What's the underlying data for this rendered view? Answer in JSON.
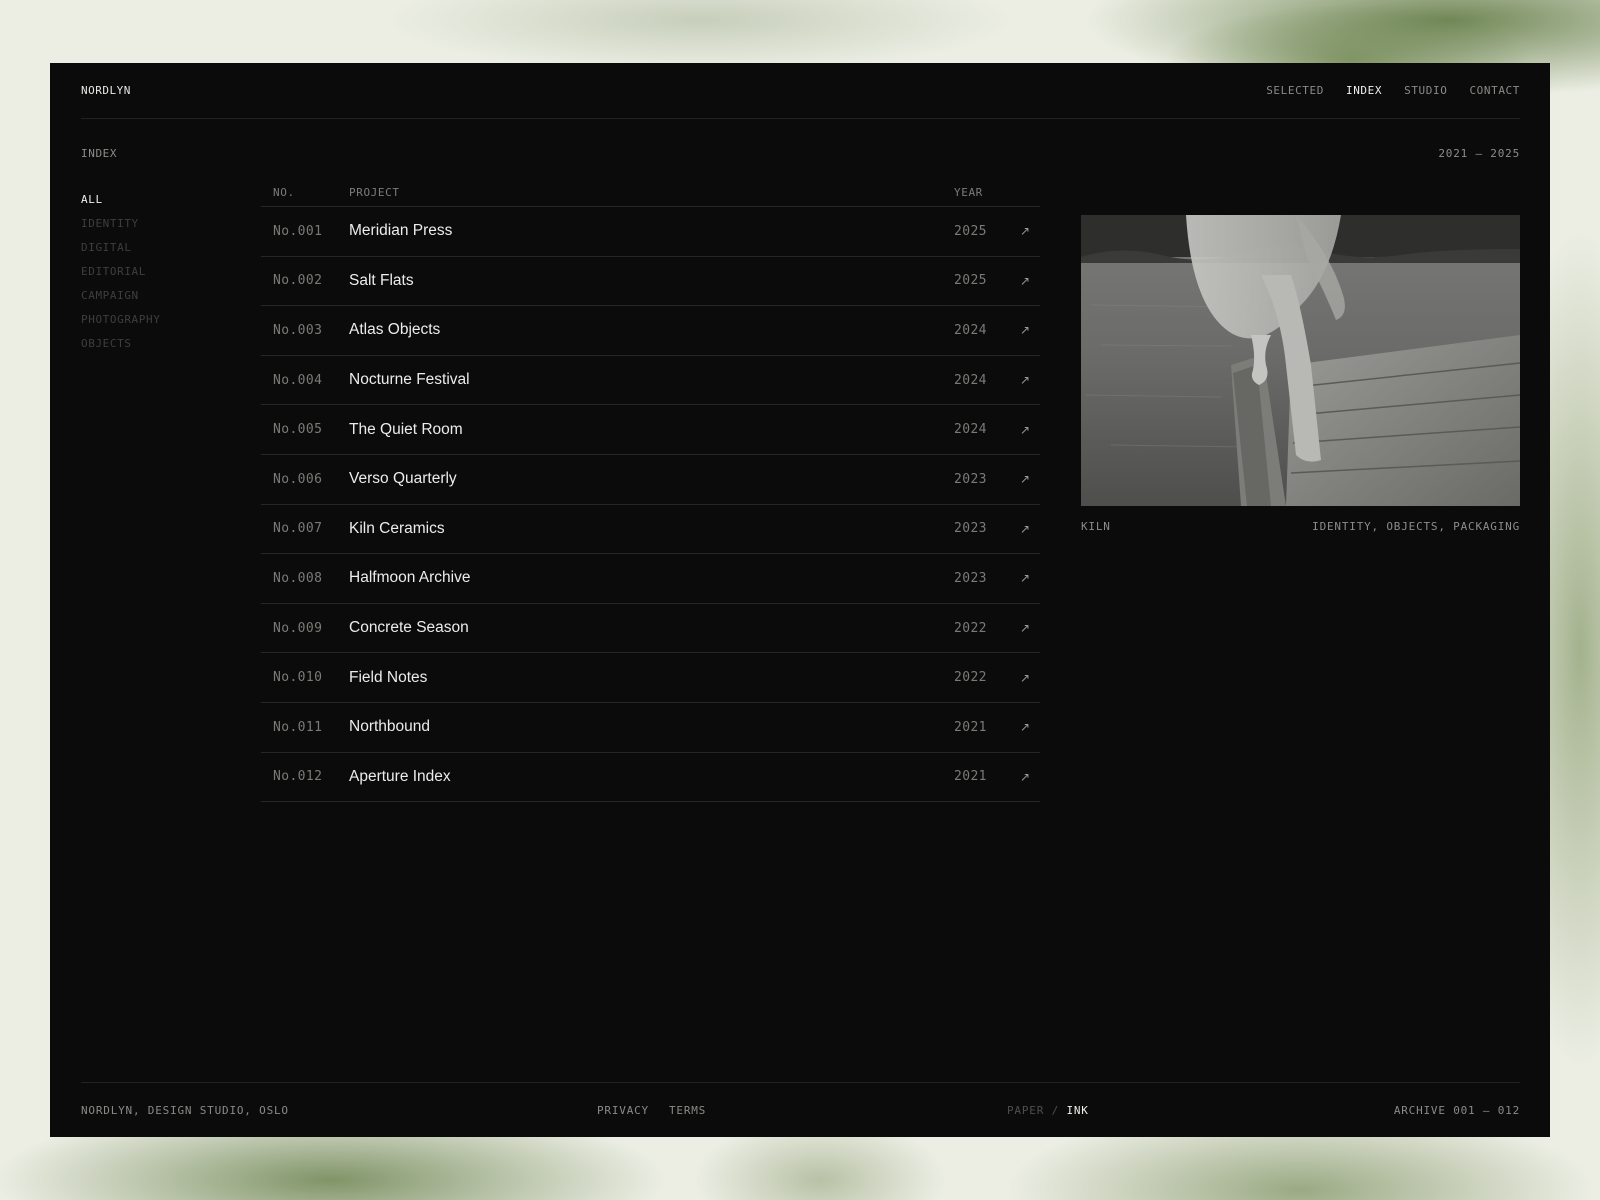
{
  "site": {
    "brand": "NORDLYN"
  },
  "nav": [
    {
      "label": "SELECTED",
      "active": false
    },
    {
      "label": "INDEX",
      "active": true
    },
    {
      "label": "STUDIO",
      "active": false
    },
    {
      "label": "CONTACT",
      "active": false
    }
  ],
  "page": {
    "section": "INDEX",
    "range": "2021 – 2025"
  },
  "filters": [
    {
      "label": "ALL",
      "active": true
    },
    {
      "label": "IDENTITY",
      "active": false
    },
    {
      "label": "DIGITAL",
      "active": false
    },
    {
      "label": "EDITORIAL",
      "active": false
    },
    {
      "label": "CAMPAIGN",
      "active": false
    },
    {
      "label": "PHOTOGRAPHY",
      "active": false
    },
    {
      "label": "OBJECTS",
      "active": false
    }
  ],
  "table": {
    "headers": {
      "no": "NO.",
      "project": "PROJECT",
      "year": "YEAR"
    },
    "rows": [
      {
        "no": "No.001",
        "name": "Meridian Press",
        "year": "2025",
        "arrow": "↗"
      },
      {
        "no": "No.002",
        "name": "Salt Flats",
        "year": "2025",
        "arrow": "↗"
      },
      {
        "no": "No.003",
        "name": "Atlas Objects",
        "year": "2024",
        "arrow": "↗"
      },
      {
        "no": "No.004",
        "name": "Nocturne Festival",
        "year": "2024",
        "arrow": "↗"
      },
      {
        "no": "No.005",
        "name": "The Quiet Room",
        "year": "2024",
        "arrow": "↗"
      },
      {
        "no": "No.006",
        "name": "Verso Quarterly",
        "year": "2023",
        "arrow": "↗"
      },
      {
        "no": "No.007",
        "name": "Kiln Ceramics",
        "year": "2023",
        "arrow": "↗"
      },
      {
        "no": "No.008",
        "name": "Halfmoon Archive",
        "year": "2023",
        "arrow": "↗"
      },
      {
        "no": "No.009",
        "name": "Concrete Season",
        "year": "2022",
        "arrow": "↗"
      },
      {
        "no": "No.010",
        "name": "Field Notes",
        "year": "2022",
        "arrow": "↗"
      },
      {
        "no": "No.011",
        "name": "Northbound",
        "year": "2021",
        "arrow": "↗"
      },
      {
        "no": "No.012",
        "name": "Aperture Index",
        "year": "2021",
        "arrow": "↗"
      }
    ]
  },
  "preview": {
    "caption_left": "KILN",
    "caption_right": "IDENTITY, OBJECTS, PACKAGING"
  },
  "footer": {
    "left": "NORDLYN, DESIGN STUDIO, OSLO",
    "links": [
      "PRIVACY",
      "TERMS"
    ],
    "theme": {
      "off": "PAPER",
      "sep": "/",
      "on": "INK"
    },
    "right": "ARCHIVE 001 – 012"
  }
}
